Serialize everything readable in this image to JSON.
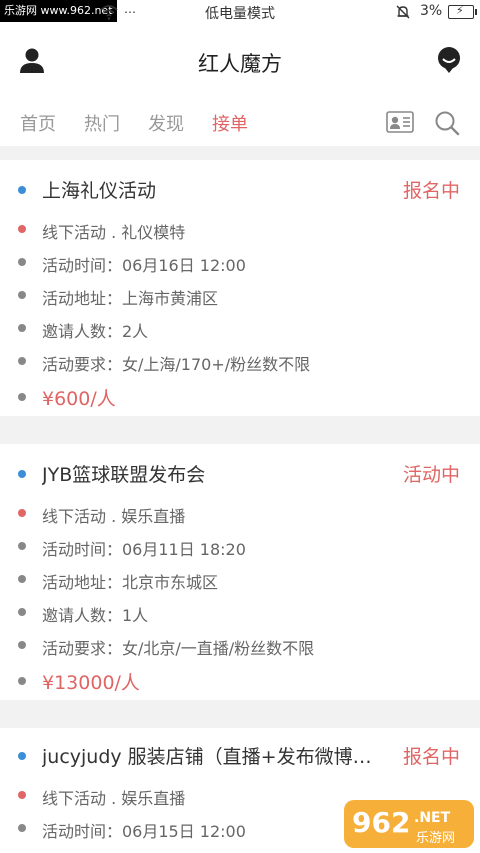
{
  "status_bar": {
    "watermark": "乐游网 www.962.net",
    "dots": "⋯",
    "mode": "低电量模式",
    "battery": "3%"
  },
  "header": {
    "title": "红人魔方"
  },
  "tabs": [
    {
      "label": "首页",
      "active": false
    },
    {
      "label": "热门",
      "active": false
    },
    {
      "label": "发现",
      "active": false
    },
    {
      "label": "接单",
      "active": true
    }
  ],
  "cards": [
    {
      "title": "上海礼仪活动",
      "status": "报名中",
      "category": "线下活动 . 礼仪模特",
      "time": "活动时间：06月16日 12:00",
      "address": "活动地址：上海市黄浦区",
      "invite": "邀请人数：2人",
      "require": "活动要求：女/上海/170+/粉丝数不限",
      "price": "¥600/人"
    },
    {
      "title": "JYB篮球联盟发布会",
      "status": "活动中",
      "category": "线下活动 . 娱乐直播",
      "time": "活动时间：06月11日 18:20",
      "address": "活动地址：北京市东城区",
      "invite": "邀请人数：1人",
      "require": "活动要求：女/北京/一直播/粉丝数不限",
      "price": "¥13000/人"
    },
    {
      "title": "jucyjudy 服装店铺（直播+发布微博微...",
      "status": "报名中",
      "category": "线下活动 . 娱乐直播",
      "time": "活动时间：06月15日 12:00"
    }
  ],
  "watermark_bottom": {
    "big": "962",
    "small": ".NET",
    "sub": "乐游网"
  },
  "colors": {
    "accent": "#e06565",
    "blue_dot": "#3b8ed8",
    "grey_dot": "#888888"
  }
}
